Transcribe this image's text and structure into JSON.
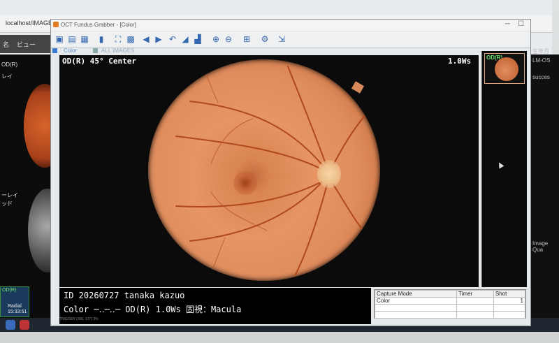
{
  "background": {
    "url": "localhost/IMAGEnet...",
    "tab_label": "ビュー",
    "left_texts": [
      "名",
      "OD(R)",
      "レイ",
      "ーレイ",
      "ッド",
      "OD(R)",
      "Radial",
      "15:33:51"
    ],
    "right_texts": [
      "生年月",
      "LM-OS",
      "succes",
      "Image Qua"
    ]
  },
  "app": {
    "title": "OCT Fundus Grabber - [Color]",
    "minimize": "─",
    "maximize": "☐",
    "tabs": [
      {
        "label": "Color"
      },
      {
        "label": "ALL IMAGES"
      }
    ]
  },
  "viewer": {
    "top_left_label": "OD(R) 45° Center",
    "top_right_label": "1.0Ws"
  },
  "thumbnail": {
    "label": "OD(R)"
  },
  "info": {
    "line1": "ID 20260727   tanaka kazuo",
    "line2": "Color ─‥─‥─  OD(R) 1.0Ws 固視：Macula",
    "status": "TRIGGER (306, 177) 3%"
  },
  "capture_table": {
    "headers": [
      "Capture Mode",
      "Timer",
      "Shot"
    ],
    "rows": [
      [
        "Color",
        "",
        "1"
      ],
      [
        "",
        "",
        ""
      ],
      [
        "",
        "",
        ""
      ]
    ]
  },
  "colors": {
    "accent": "#3a7bd5",
    "thumb_label": "#6ee06e",
    "fundus": "#e08d5d"
  }
}
